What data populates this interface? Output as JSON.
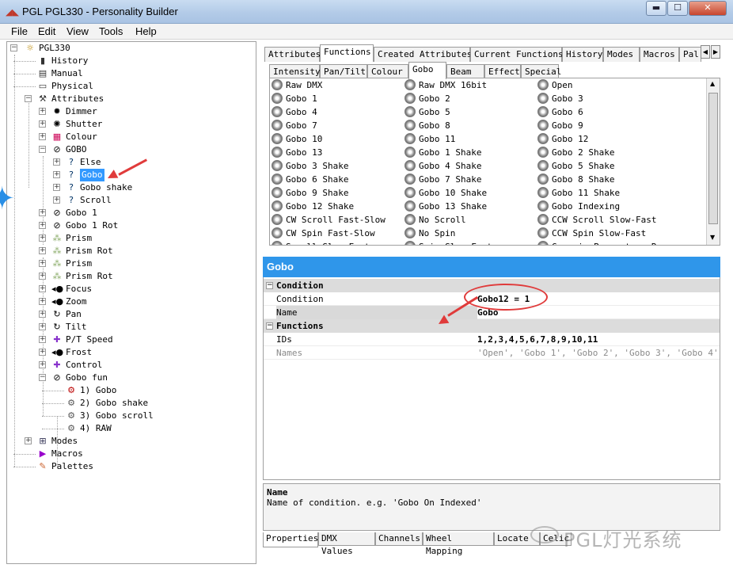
{
  "window": {
    "title": "PGL PGL330 - Personality Builder",
    "icon": "pgl-logo-icon",
    "min": "▬",
    "max": "☐",
    "close": "✕"
  },
  "menu": [
    "File",
    "Edit",
    "View",
    "Tools",
    "Help"
  ],
  "tree": {
    "root": "PGL330",
    "nodes": [
      {
        "label": "History",
        "icon": "book-icon",
        "glyph": "▮",
        "color": "#333"
      },
      {
        "label": "Manual",
        "icon": "manual-icon",
        "glyph": "▤",
        "color": "#333"
      },
      {
        "label": "Physical",
        "icon": "physical-icon",
        "glyph": "▭",
        "color": "#333"
      },
      {
        "label": "Attributes",
        "icon": "wrench-icon",
        "glyph": "⚒",
        "color": "#333"
      },
      {
        "label": "Dimmer",
        "icon": "dimmer-icon",
        "glyph": "✹",
        "color": "#000"
      },
      {
        "label": "Shutter",
        "icon": "shutter-icon",
        "glyph": "✺",
        "color": "#000"
      },
      {
        "label": "Colour",
        "icon": "colour-icon",
        "glyph": "▦",
        "color": "#c05"
      },
      {
        "label": "GOBO",
        "icon": "gobo-icon",
        "glyph": "⊘",
        "color": "#000"
      },
      {
        "label": "Else",
        "icon": "question-icon",
        "glyph": "?",
        "color": "#036"
      },
      {
        "label": "Gobo",
        "icon": "question-icon",
        "glyph": "?",
        "color": "#036"
      },
      {
        "label": "Gobo shake",
        "icon": "question-icon",
        "glyph": "?",
        "color": "#036"
      },
      {
        "label": "Scroll",
        "icon": "question-icon",
        "glyph": "?",
        "color": "#036"
      },
      {
        "label": "Gobo 1",
        "icon": "gobo-icon",
        "glyph": "⊘",
        "color": "#000"
      },
      {
        "label": "Gobo 1 Rot",
        "icon": "gobo-icon",
        "glyph": "⊘",
        "color": "#000"
      },
      {
        "label": "Prism",
        "icon": "prism-icon",
        "glyph": "⁂",
        "color": "#8a6"
      },
      {
        "label": "Prism Rot",
        "icon": "prism-icon",
        "glyph": "⁂",
        "color": "#8a6"
      },
      {
        "label": "Prism",
        "icon": "prism-icon",
        "glyph": "⁂",
        "color": "#8a6"
      },
      {
        "label": "Prism Rot",
        "icon": "prism-icon",
        "glyph": "⁂",
        "color": "#8a6"
      },
      {
        "label": "Focus",
        "icon": "focus-icon",
        "glyph": "◂●",
        "color": "#000"
      },
      {
        "label": "Zoom",
        "icon": "zoom-icon",
        "glyph": "◂●",
        "color": "#000"
      },
      {
        "label": "Pan",
        "icon": "pan-icon",
        "glyph": "↻",
        "color": "#000"
      },
      {
        "label": "Tilt",
        "icon": "tilt-icon",
        "glyph": "↻",
        "color": "#000"
      },
      {
        "label": "P/T Speed",
        "icon": "speed-icon",
        "glyph": "✚",
        "color": "#83c"
      },
      {
        "label": "Frost",
        "icon": "frost-icon",
        "glyph": "◂●",
        "color": "#000"
      },
      {
        "label": "Control",
        "icon": "control-icon",
        "glyph": "✚",
        "color": "#83c"
      },
      {
        "label": "Gobo fun",
        "icon": "gobo-icon",
        "glyph": "⊘",
        "color": "#000"
      },
      {
        "label": "1) Gobo",
        "icon": "macro-step-icon",
        "glyph": "⚙",
        "color": "#b00"
      },
      {
        "label": "2) Gobo shake",
        "icon": "macro-step-icon",
        "glyph": "⚙",
        "color": "#555"
      },
      {
        "label": "3) Gobo scroll",
        "icon": "macro-step-icon",
        "glyph": "⚙",
        "color": "#555"
      },
      {
        "label": "4) RAW",
        "icon": "macro-step-icon",
        "glyph": "⚙",
        "color": "#555"
      },
      {
        "label": "Modes",
        "icon": "modes-icon",
        "glyph": "⊞",
        "color": "#335"
      },
      {
        "label": "Macros",
        "icon": "macros-icon",
        "glyph": "▶",
        "color": "#90c"
      },
      {
        "label": "Palettes",
        "icon": "palette-icon",
        "glyph": "✎",
        "color": "#c63"
      }
    ]
  },
  "tabs_top": [
    "Attributes",
    "Functions",
    "Created Attributes",
    "Current Functions",
    "History",
    "Modes",
    "Macros",
    "Pal"
  ],
  "tabs_sub": [
    "Intensity",
    "Pan/Tilt",
    "Colour",
    "Gobo",
    "Beam",
    "Effect",
    "Special"
  ],
  "functions": [
    [
      "Raw DMX",
      "Raw DMX 16bit",
      "Open"
    ],
    [
      "Gobo 1",
      "Gobo 2",
      "Gobo 3"
    ],
    [
      "Gobo 4",
      "Gobo 5",
      "Gobo 6"
    ],
    [
      "Gobo 7",
      "Gobo 8",
      "Gobo 9"
    ],
    [
      "Gobo 10",
      "Gobo 11",
      "Gobo 12"
    ],
    [
      "Gobo 13",
      "Gobo 1 Shake",
      "Gobo 2 Shake"
    ],
    [
      "Gobo 3 Shake",
      "Gobo 4 Shake",
      "Gobo 5 Shake"
    ],
    [
      "Gobo 6 Shake",
      "Gobo 7 Shake",
      "Gobo 8 Shake"
    ],
    [
      "Gobo 9 Shake",
      "Gobo 10 Shake",
      "Gobo 11 Shake"
    ],
    [
      "Gobo 12 Shake",
      "Gobo 13 Shake",
      "Gobo Indexing"
    ],
    [
      "CW Scroll Fast-Slow",
      "No Scroll",
      "CCW Scroll Slow-Fast"
    ],
    [
      "CW Spin Fast-Slow",
      "No Spin",
      "CCW Spin Slow-Fast"
    ],
    [
      "Scroll Slow-Fast",
      "Spin Slow-Fast",
      "Generic Percentage Range"
    ]
  ],
  "properties": {
    "header": "Gobo",
    "cat_condition": "Condition",
    "condition_label": "Condition",
    "condition_value": "Gobo12 = 1",
    "name_label": "Name",
    "name_value": "Gobo",
    "cat_functions": "Functions",
    "ids_label": "IDs",
    "ids_value": "1,2,3,4,5,6,7,8,9,10,11",
    "names_label": "Names",
    "names_value": "'Open', 'Gobo 1', 'Gobo 2', 'Gobo 3', 'Gobo 4', 'Gobo"
  },
  "help": {
    "title": "Name",
    "text": "Name of condition. e.g. 'Gobo On Indexed'"
  },
  "tabs_bottom": [
    "Properties",
    "DMX Values",
    "Channels",
    "Wheel Mapping",
    "Locate",
    "Celic"
  ],
  "watermark": "PGL灯光系统",
  "annotation_color": "#e03b3b"
}
